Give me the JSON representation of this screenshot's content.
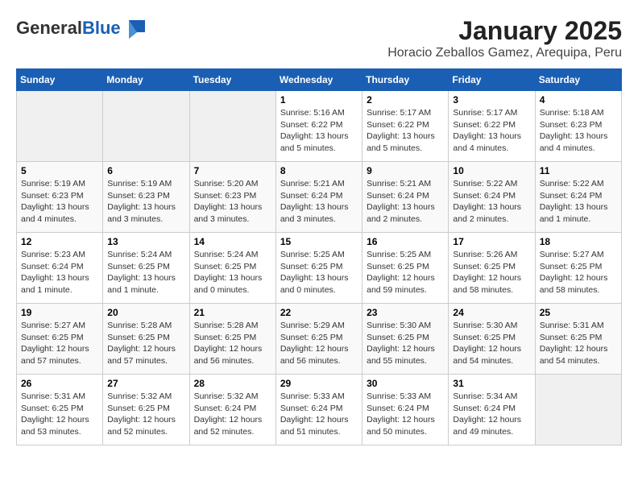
{
  "header": {
    "logo_general": "General",
    "logo_blue": "Blue",
    "title": "January 2025",
    "subtitle": "Horacio Zeballos Gamez, Arequipa, Peru"
  },
  "weekdays": [
    "Sunday",
    "Monday",
    "Tuesday",
    "Wednesday",
    "Thursday",
    "Friday",
    "Saturday"
  ],
  "weeks": [
    [
      {
        "day": "",
        "info": ""
      },
      {
        "day": "",
        "info": ""
      },
      {
        "day": "",
        "info": ""
      },
      {
        "day": "1",
        "info": "Sunrise: 5:16 AM\nSunset: 6:22 PM\nDaylight: 13 hours\nand 5 minutes."
      },
      {
        "day": "2",
        "info": "Sunrise: 5:17 AM\nSunset: 6:22 PM\nDaylight: 13 hours\nand 5 minutes."
      },
      {
        "day": "3",
        "info": "Sunrise: 5:17 AM\nSunset: 6:22 PM\nDaylight: 13 hours\nand 4 minutes."
      },
      {
        "day": "4",
        "info": "Sunrise: 5:18 AM\nSunset: 6:23 PM\nDaylight: 13 hours\nand 4 minutes."
      }
    ],
    [
      {
        "day": "5",
        "info": "Sunrise: 5:19 AM\nSunset: 6:23 PM\nDaylight: 13 hours\nand 4 minutes."
      },
      {
        "day": "6",
        "info": "Sunrise: 5:19 AM\nSunset: 6:23 PM\nDaylight: 13 hours\nand 3 minutes."
      },
      {
        "day": "7",
        "info": "Sunrise: 5:20 AM\nSunset: 6:23 PM\nDaylight: 13 hours\nand 3 minutes."
      },
      {
        "day": "8",
        "info": "Sunrise: 5:21 AM\nSunset: 6:24 PM\nDaylight: 13 hours\nand 3 minutes."
      },
      {
        "day": "9",
        "info": "Sunrise: 5:21 AM\nSunset: 6:24 PM\nDaylight: 13 hours\nand 2 minutes."
      },
      {
        "day": "10",
        "info": "Sunrise: 5:22 AM\nSunset: 6:24 PM\nDaylight: 13 hours\nand 2 minutes."
      },
      {
        "day": "11",
        "info": "Sunrise: 5:22 AM\nSunset: 6:24 PM\nDaylight: 13 hours\nand 1 minute."
      }
    ],
    [
      {
        "day": "12",
        "info": "Sunrise: 5:23 AM\nSunset: 6:24 PM\nDaylight: 13 hours\nand 1 minute."
      },
      {
        "day": "13",
        "info": "Sunrise: 5:24 AM\nSunset: 6:25 PM\nDaylight: 13 hours\nand 1 minute."
      },
      {
        "day": "14",
        "info": "Sunrise: 5:24 AM\nSunset: 6:25 PM\nDaylight: 13 hours\nand 0 minutes."
      },
      {
        "day": "15",
        "info": "Sunrise: 5:25 AM\nSunset: 6:25 PM\nDaylight: 13 hours\nand 0 minutes."
      },
      {
        "day": "16",
        "info": "Sunrise: 5:25 AM\nSunset: 6:25 PM\nDaylight: 12 hours\nand 59 minutes."
      },
      {
        "day": "17",
        "info": "Sunrise: 5:26 AM\nSunset: 6:25 PM\nDaylight: 12 hours\nand 58 minutes."
      },
      {
        "day": "18",
        "info": "Sunrise: 5:27 AM\nSunset: 6:25 PM\nDaylight: 12 hours\nand 58 minutes."
      }
    ],
    [
      {
        "day": "19",
        "info": "Sunrise: 5:27 AM\nSunset: 6:25 PM\nDaylight: 12 hours\nand 57 minutes."
      },
      {
        "day": "20",
        "info": "Sunrise: 5:28 AM\nSunset: 6:25 PM\nDaylight: 12 hours\nand 57 minutes."
      },
      {
        "day": "21",
        "info": "Sunrise: 5:28 AM\nSunset: 6:25 PM\nDaylight: 12 hours\nand 56 minutes."
      },
      {
        "day": "22",
        "info": "Sunrise: 5:29 AM\nSunset: 6:25 PM\nDaylight: 12 hours\nand 56 minutes."
      },
      {
        "day": "23",
        "info": "Sunrise: 5:30 AM\nSunset: 6:25 PM\nDaylight: 12 hours\nand 55 minutes."
      },
      {
        "day": "24",
        "info": "Sunrise: 5:30 AM\nSunset: 6:25 PM\nDaylight: 12 hours\nand 54 minutes."
      },
      {
        "day": "25",
        "info": "Sunrise: 5:31 AM\nSunset: 6:25 PM\nDaylight: 12 hours\nand 54 minutes."
      }
    ],
    [
      {
        "day": "26",
        "info": "Sunrise: 5:31 AM\nSunset: 6:25 PM\nDaylight: 12 hours\nand 53 minutes."
      },
      {
        "day": "27",
        "info": "Sunrise: 5:32 AM\nSunset: 6:25 PM\nDaylight: 12 hours\nand 52 minutes."
      },
      {
        "day": "28",
        "info": "Sunrise: 5:32 AM\nSunset: 6:24 PM\nDaylight: 12 hours\nand 52 minutes."
      },
      {
        "day": "29",
        "info": "Sunrise: 5:33 AM\nSunset: 6:24 PM\nDaylight: 12 hours\nand 51 minutes."
      },
      {
        "day": "30",
        "info": "Sunrise: 5:33 AM\nSunset: 6:24 PM\nDaylight: 12 hours\nand 50 minutes."
      },
      {
        "day": "31",
        "info": "Sunrise: 5:34 AM\nSunset: 6:24 PM\nDaylight: 12 hours\nand 49 minutes."
      },
      {
        "day": "",
        "info": ""
      }
    ]
  ]
}
